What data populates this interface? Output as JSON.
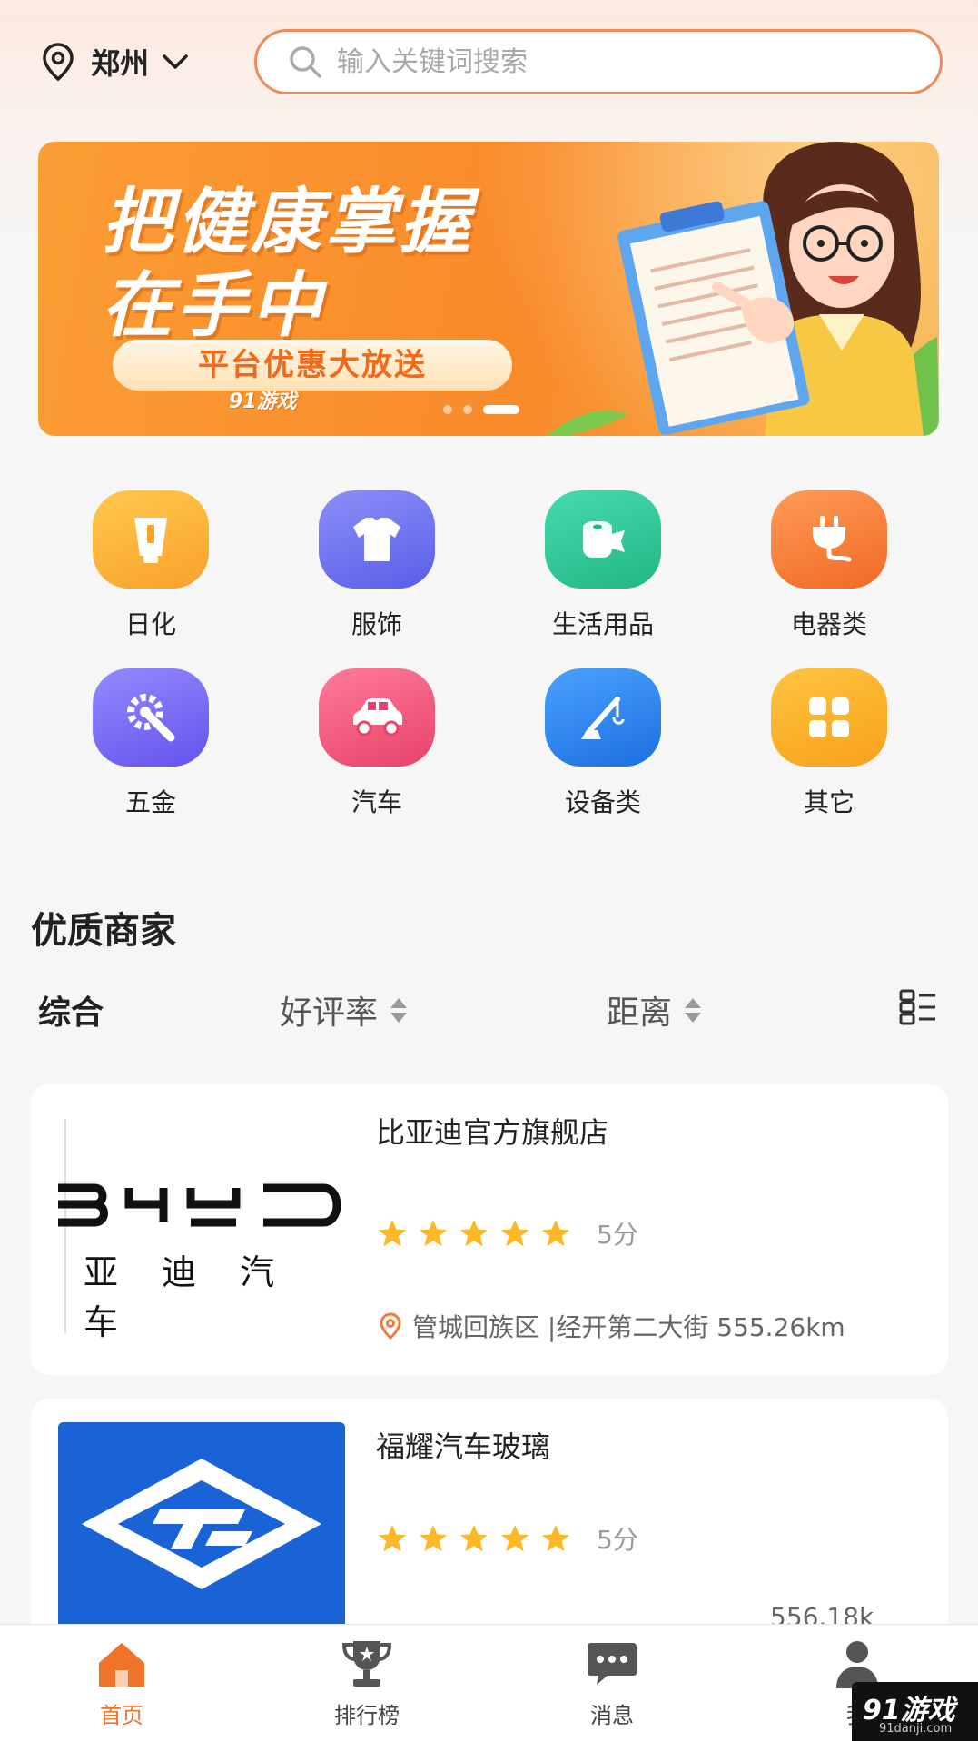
{
  "header": {
    "city": "郑州",
    "search_placeholder": "输入关键词搜索"
  },
  "banner": {
    "title_line1": "把健康掌握",
    "title_line2": "在手中",
    "pill_text": "平台优惠大放送",
    "watermark": "91游戏",
    "slide_count": 3,
    "active_slide": 3
  },
  "categories": [
    {
      "label": "日化",
      "color": "#fbb03b",
      "icon": "tube-icon"
    },
    {
      "label": "服饰",
      "color": "#6c72f0",
      "icon": "shirt-icon"
    },
    {
      "label": "生活用品",
      "color": "#2fc99a",
      "icon": "tissue-roll-icon"
    },
    {
      "label": "电器类",
      "color": "#f47b3a",
      "icon": "plug-icon"
    },
    {
      "label": "五金",
      "color": "#7b6bf2",
      "icon": "wrench-gear-icon"
    },
    {
      "label": "汽车",
      "color": "#f2577a",
      "icon": "car-icon"
    },
    {
      "label": "设备类",
      "color": "#2b84f0",
      "icon": "crane-icon"
    },
    {
      "label": "其它",
      "color": "#fbb02e",
      "icon": "grid-icon"
    }
  ],
  "section": {
    "title": "优质商家",
    "filters": [
      "综合",
      "好评率",
      "距离"
    ]
  },
  "shops": [
    {
      "name": "比亚迪官方旗舰店",
      "logo_text": "亚 迪 汽 车",
      "rating": 5,
      "score": "5分",
      "address": "管城回族区 |经开第二大街 555.26km"
    },
    {
      "name": "福耀汽车玻璃",
      "rating": 5,
      "score": "5分",
      "distance_partial": "556.18k"
    }
  ],
  "nav": {
    "items": [
      "首页",
      "排行榜",
      "消息",
      "我"
    ],
    "active_color": "#f0732a"
  },
  "corner_watermark": {
    "title": "91游戏",
    "sub": "91danji.com"
  }
}
